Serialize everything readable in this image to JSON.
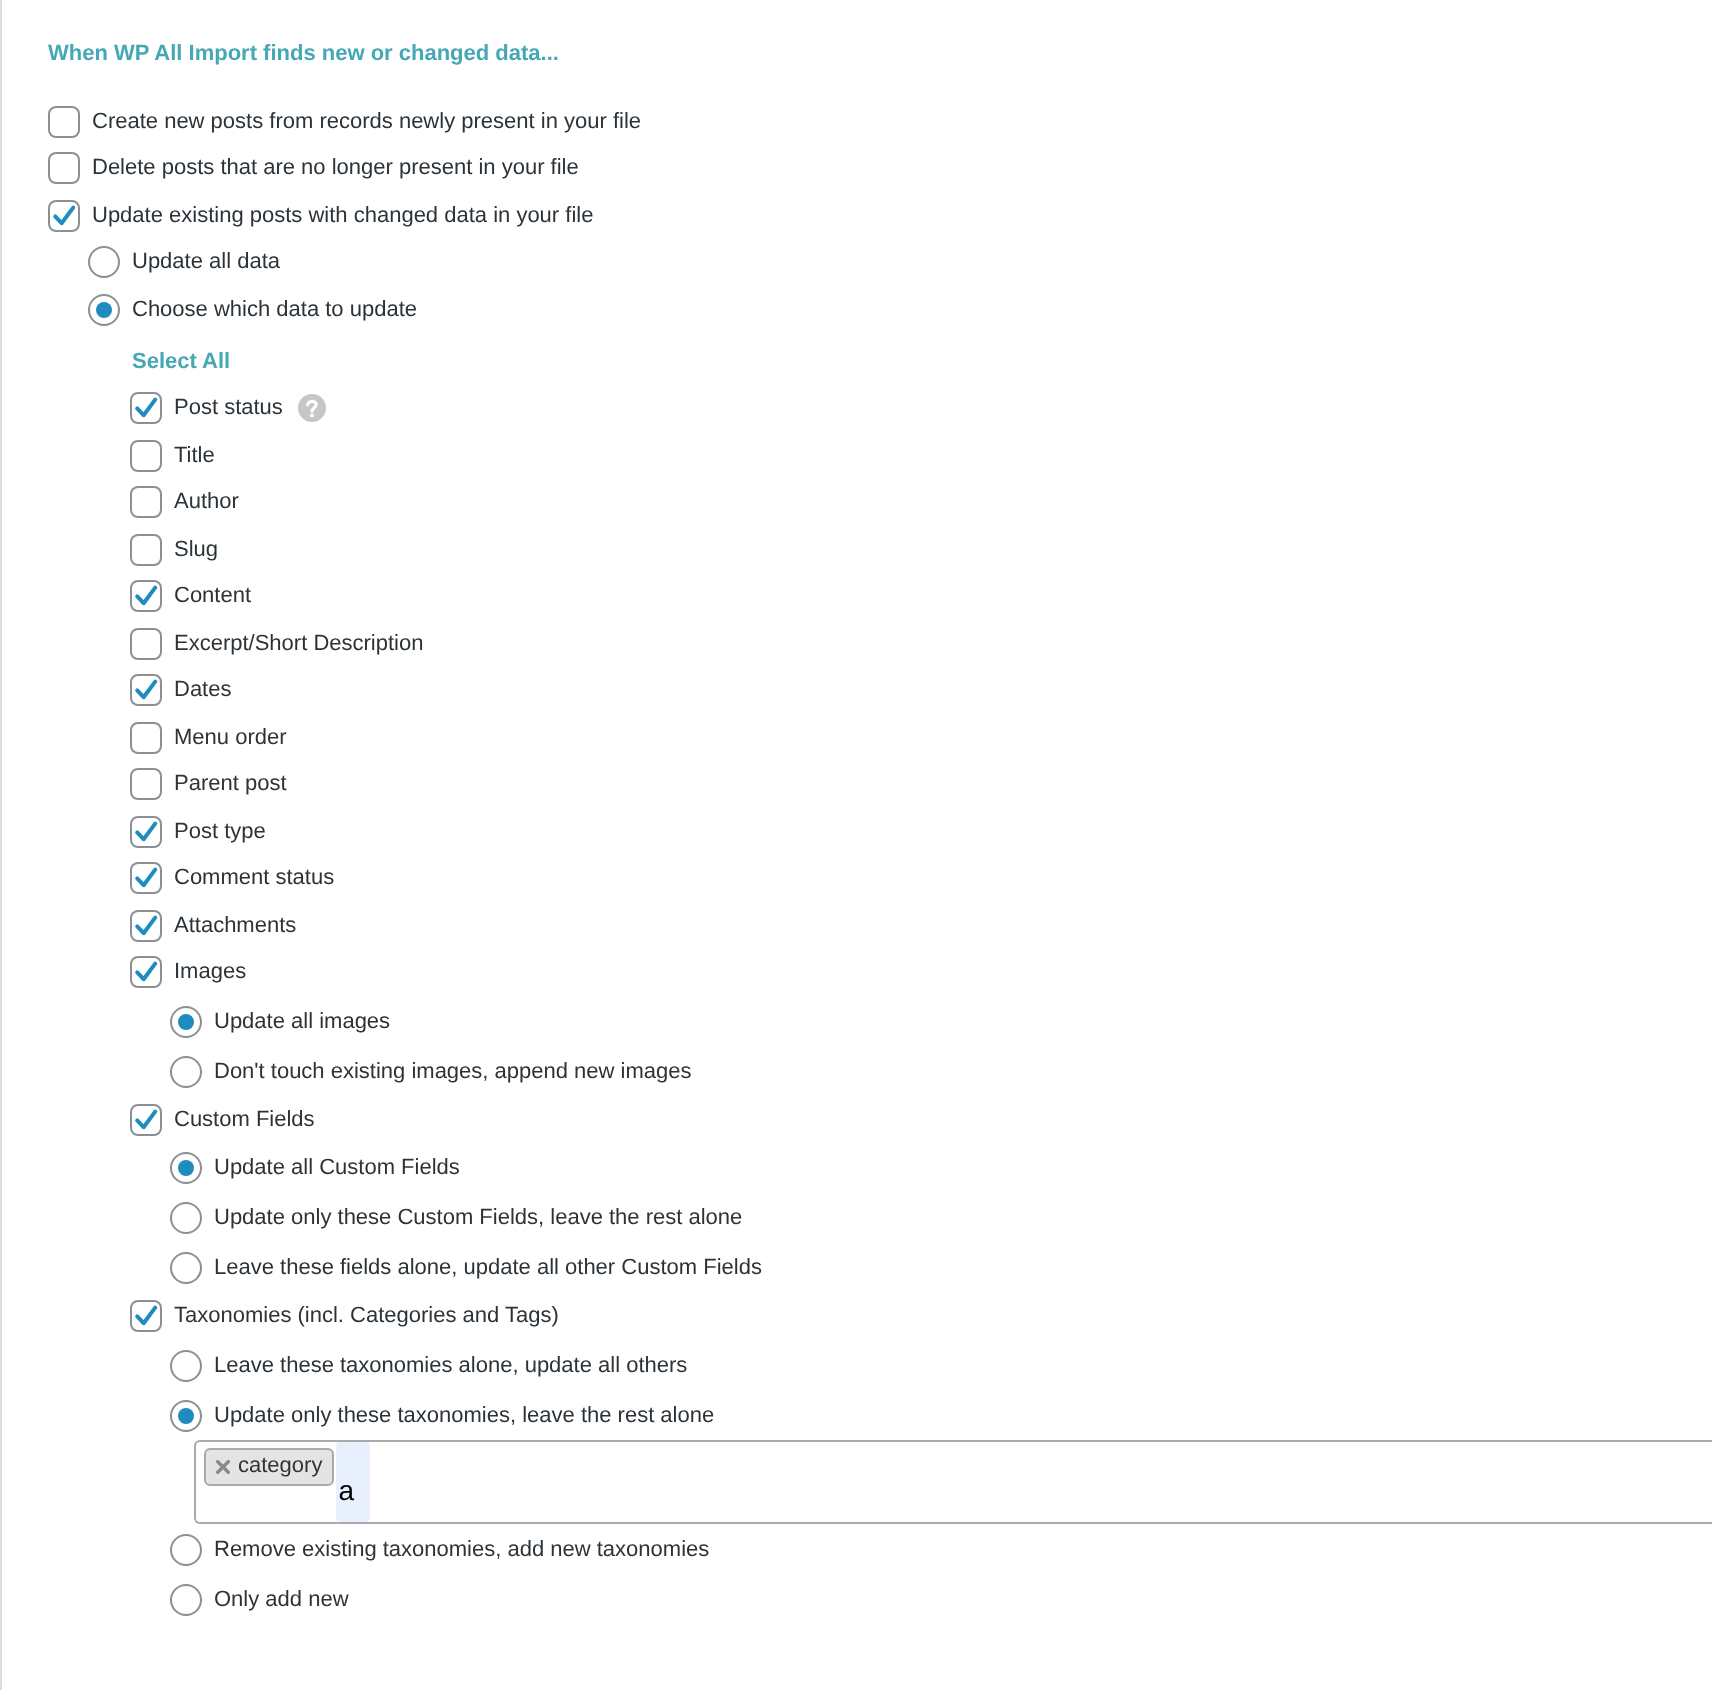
{
  "heading": "When WP All Import finds new or changed data...",
  "options": [
    {
      "label": "Create new posts from records newly present in your file",
      "checked": false
    },
    {
      "label": "Delete posts that are no longer present in your file",
      "checked": false
    },
    {
      "label": "Update existing posts with changed data in your file",
      "checked": true,
      "modes": [
        {
          "label": "Update all data",
          "selected": false
        },
        {
          "label": "Choose which data to update",
          "selected": true,
          "select_all": "Select All",
          "fields": [
            {
              "label": "Post status",
              "checked": true,
              "help": true
            },
            {
              "label": "Title",
              "checked": false
            },
            {
              "label": "Author",
              "checked": false
            },
            {
              "label": "Slug",
              "checked": false
            },
            {
              "label": "Content",
              "checked": true
            },
            {
              "label": "Excerpt/Short Description",
              "checked": false
            },
            {
              "label": "Dates",
              "checked": true
            },
            {
              "label": "Menu order",
              "checked": false
            },
            {
              "label": "Parent post",
              "checked": false
            },
            {
              "label": "Post type",
              "checked": true
            },
            {
              "label": "Comment status",
              "checked": true
            },
            {
              "label": "Attachments",
              "checked": true
            },
            {
              "label": "Images",
              "checked": true,
              "choices": [
                {
                  "label": "Update all images",
                  "selected": true
                },
                {
                  "label": "Don't touch existing images, append new images",
                  "selected": false
                }
              ]
            },
            {
              "label": "Custom Fields",
              "checked": true,
              "choices": [
                {
                  "label": "Update all Custom Fields",
                  "selected": true
                },
                {
                  "label": "Update only these Custom Fields, leave the rest alone",
                  "selected": false
                },
                {
                  "label": "Leave these fields alone, update all other Custom Fields",
                  "selected": false
                }
              ]
            },
            {
              "label": "Taxonomies (incl. Categories and Tags)",
              "checked": true,
              "choices": [
                {
                  "label": "Leave these taxonomies alone, update all others",
                  "selected": false
                },
                {
                  "label": "Update only these taxonomies, leave the rest alone",
                  "selected": true,
                  "taxonomy_input": {
                    "tags": [
                      "category"
                    ],
                    "value": "a"
                  }
                },
                {
                  "label": "Remove existing taxonomies, add new taxonomies",
                  "selected": false
                },
                {
                  "label": "Only add new",
                  "selected": false
                }
              ]
            }
          ]
        }
      ]
    }
  ]
}
